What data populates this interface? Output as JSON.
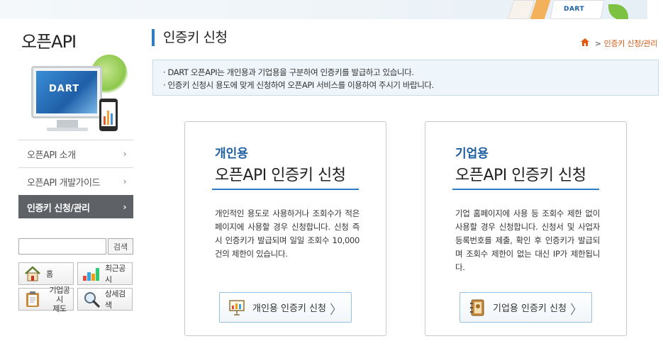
{
  "banner": {
    "brand_text": "DART"
  },
  "sidebar": {
    "title": "오픈API",
    "hero_logo": "DART",
    "menu": [
      {
        "label": "오픈API 소개",
        "active": false
      },
      {
        "label": "오픈API 개발가이드",
        "active": false
      },
      {
        "label": "인증키 신청/관리",
        "active": true
      }
    ],
    "search": {
      "value": "",
      "button_label": "검색"
    },
    "quick_links": [
      {
        "label": "홈",
        "icon": "house-icon"
      },
      {
        "label": "최근공시",
        "icon": "bar-chart-icon"
      },
      {
        "label": "기업공시\n제도",
        "icon": "clipboard-icon"
      },
      {
        "label": "상세검색",
        "icon": "magnifier-icon"
      }
    ]
  },
  "main": {
    "title": "인증키 신청",
    "breadcrumb": {
      "current": "인증키 신청/관리"
    },
    "notice": [
      "· DART 오픈API는 개인용과 기업용을 구분하여 인증키를 발급하고 있습니다.",
      "· 인증키 신청시 용도에 맞게 신청하여 오픈API 서비스를 이용하여 주시기 바랍니다."
    ],
    "cards": {
      "personal": {
        "kind": "개인용",
        "headline": "오픈API 인증키 신청",
        "desc": "개인적인 용도로 사용하거나 조회수가 적은 페이지에 사용할 경우 신청합니다. 신청 즉시 인증키가 발급되며 일일 조회수 10,000건의 제한이 있습니다.",
        "button": "개인용 인증키 신청"
      },
      "corporate": {
        "kind": "기업용",
        "headline": "오픈API 인증키 신청",
        "desc": "기업 홈페이지에 사용 등 조회수 제한 없이 사용할 경우 신청합니다. 신청서 및 사업자등록번호를 제출, 확인 후 인증키가 발급되며 조회수 제한이 없는 대신 IP가 제한됩니다.",
        "button": "기업용 인증키 신청"
      }
    }
  },
  "colors": {
    "accent": "#2f7bc4",
    "brand_blue": "#1f5fa3",
    "breadcrumb": "#d45a17",
    "active_menu_bg": "#5e6166",
    "notice_bg": "#eef6fb"
  }
}
